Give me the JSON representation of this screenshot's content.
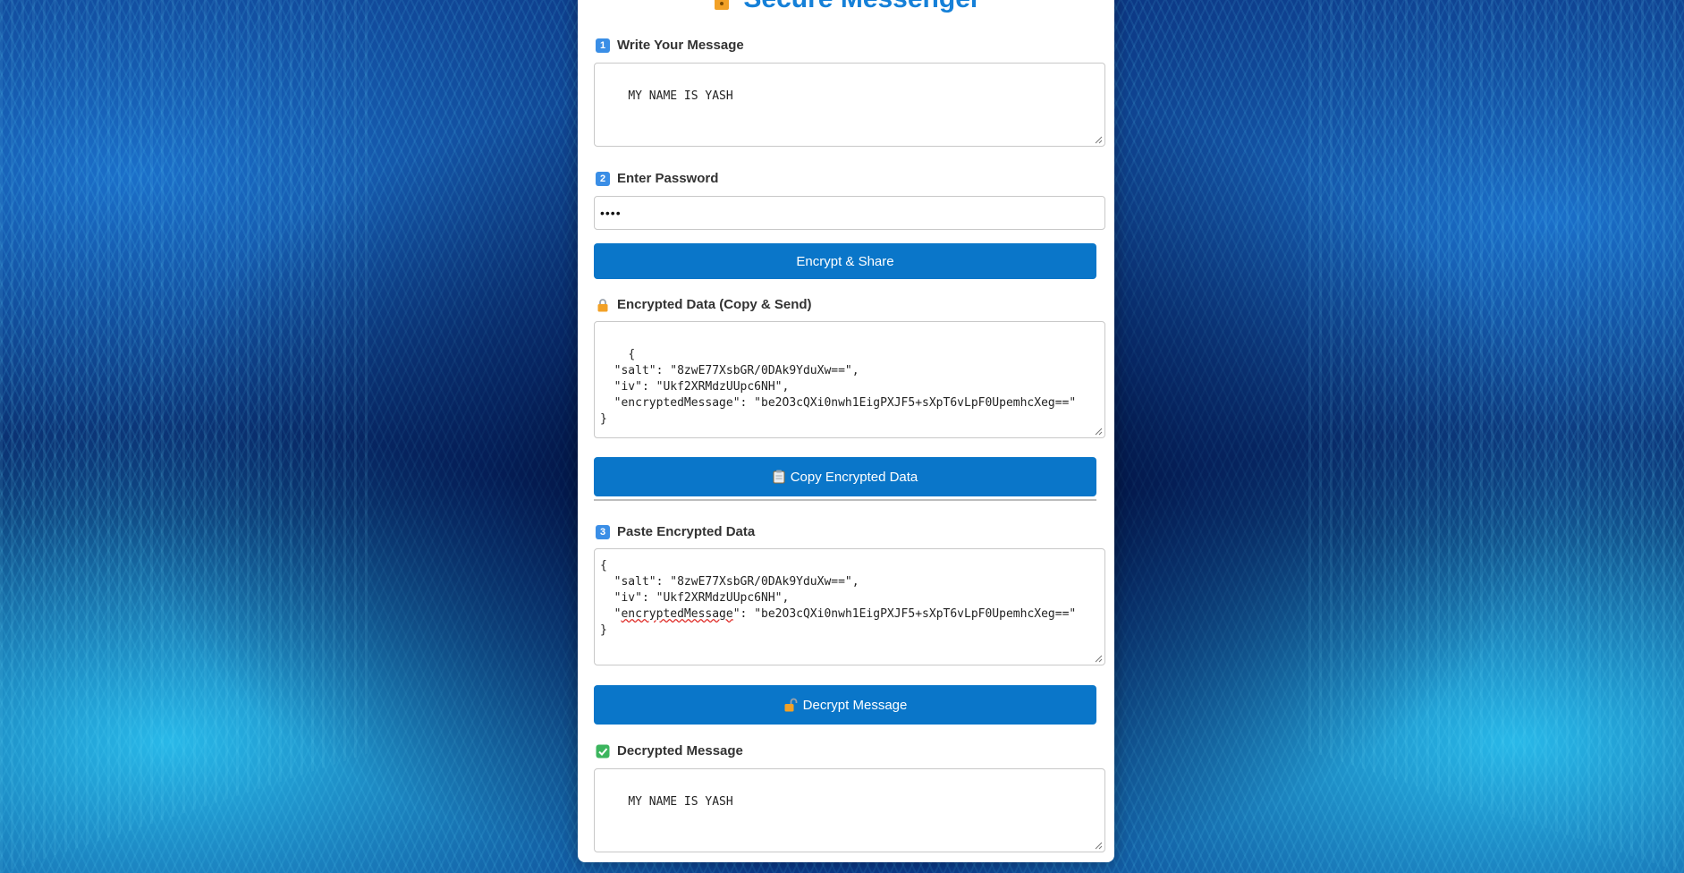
{
  "app": {
    "title": "Secure Messenger"
  },
  "write_section": {
    "label": "Write Your Message",
    "badge": "1",
    "message": "MY NAME IS YASH"
  },
  "password_section": {
    "label": "Enter Password",
    "badge": "2",
    "masked_value": "••••"
  },
  "encrypt_button": {
    "label": "Encrypt & Share"
  },
  "encrypted_section": {
    "label": "Encrypted Data (Copy & Send)",
    "icon": "lock-icon",
    "data": "{\n  \"salt\": \"8zwE77XsbGR/0DAk9YduXw==\",\n  \"iv\": \"Ukf2XRMdzUUpc6NH\",\n  \"encryptedMessage\": \"be2O3cQXi0nwh1EigPXJF5+sXpT6vLpF0UpemhcXeg==\"\n}"
  },
  "copy_button": {
    "label": "Copy Encrypted Data",
    "icon": "clipboard-icon"
  },
  "paste_section": {
    "label": "Paste Encrypted Data",
    "badge": "3",
    "line_open": "{",
    "line_salt": "  \"salt\": \"8zwE77XsbGR/0DAk9YduXw==\",",
    "line_iv": "  \"iv\": \"Ukf2XRMdzUUpc6NH\",",
    "line_msg_pre": "  \"",
    "line_msg_key": "encryptedMessage",
    "line_msg_post": "\": \"be2O3cQXi0nwh1EigPXJF5+sXpT6vLpF0UpemhcXeg==\"",
    "line_close": "}"
  },
  "decrypt_button": {
    "label": "Decrypt Message",
    "icon": "unlock-icon"
  },
  "decrypted_section": {
    "label": "Decrypted Message",
    "icon": "check-icon",
    "message": "MY NAME IS YASH"
  },
  "colors": {
    "accent": "#0a76c9",
    "title": "#1580d8"
  }
}
